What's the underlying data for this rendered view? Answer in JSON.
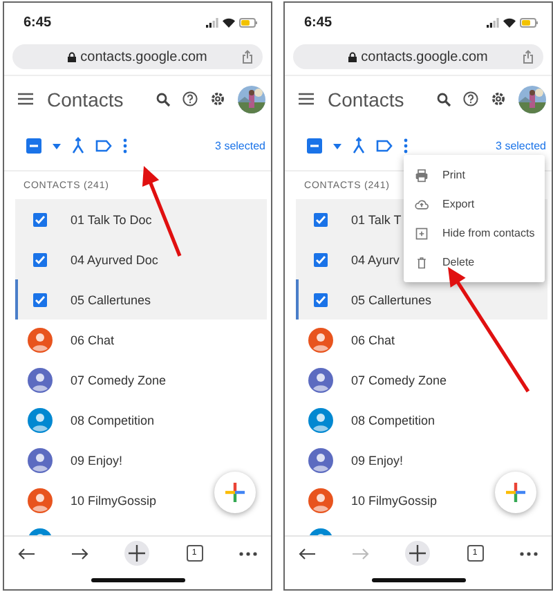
{
  "screens": [
    {
      "status": {
        "time": "6:45"
      },
      "url": "contacts.google.com",
      "app_title": "Contacts",
      "selection": {
        "count_label": "3 selected"
      },
      "section_label": "CONTACTS (241)",
      "contacts": [
        {
          "name": "01 Talk To Doc",
          "selected": true,
          "focused": false
        },
        {
          "name": "04 Ayurved Doc",
          "selected": true,
          "focused": false
        },
        {
          "name": "05 Callertunes",
          "selected": true,
          "focused": true
        },
        {
          "name": "06 Chat",
          "selected": false,
          "focused": false,
          "color": "#e8541e"
        },
        {
          "name": "07 Comedy Zone",
          "selected": false,
          "focused": false,
          "color": "#5c6bc0"
        },
        {
          "name": "08 Competition",
          "selected": false,
          "focused": false,
          "color": "#0288d1"
        },
        {
          "name": "09 Enjoy!",
          "selected": false,
          "focused": false,
          "color": "#5c6bc0"
        },
        {
          "name": "10 FilmyGossip",
          "selected": false,
          "focused": false,
          "color": "#e8541e"
        },
        {
          "selected": false,
          "focused": false,
          "color": "#0288d1"
        }
      ],
      "browser_bar": {
        "forward_disabled": false,
        "tab_count": "1"
      }
    },
    {
      "status": {
        "time": "6:45"
      },
      "url": "contacts.google.com",
      "app_title": "Contacts",
      "selection": {
        "count_label": "3 selected"
      },
      "section_label": "CONTACTS (241)",
      "contacts": [
        {
          "name": "01 Talk T",
          "selected": true,
          "focused": false
        },
        {
          "name": "04 Ayurv",
          "selected": true,
          "focused": false
        },
        {
          "name": "05 Callertunes",
          "selected": true,
          "focused": true
        },
        {
          "name": "06 Chat",
          "selected": false,
          "focused": false,
          "color": "#e8541e"
        },
        {
          "name": "07 Comedy Zone",
          "selected": false,
          "focused": false,
          "color": "#5c6bc0"
        },
        {
          "name": "08 Competition",
          "selected": false,
          "focused": false,
          "color": "#0288d1"
        },
        {
          "name": "09 Enjoy!",
          "selected": false,
          "focused": false,
          "color": "#5c6bc0"
        },
        {
          "name": "10 FilmyGossip",
          "selected": false,
          "focused": false,
          "color": "#e8541e"
        },
        {
          "selected": false,
          "focused": false,
          "color": "#0288d1"
        }
      ],
      "menu": [
        {
          "kind": "print",
          "label": "Print"
        },
        {
          "kind": "export",
          "label": "Export"
        },
        {
          "kind": "hide",
          "label": "Hide from contacts"
        },
        {
          "kind": "delete",
          "label": "Delete"
        }
      ],
      "browser_bar": {
        "forward_disabled": true,
        "tab_count": "1"
      }
    }
  ]
}
